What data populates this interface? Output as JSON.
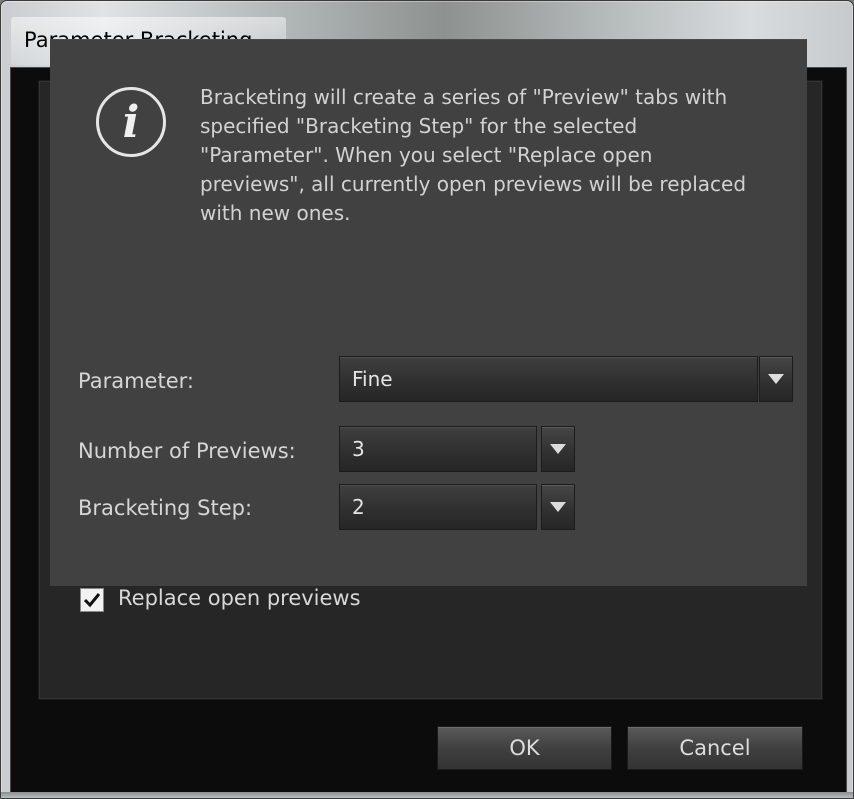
{
  "window": {
    "title": "Parameter Bracketing"
  },
  "info": {
    "icon_glyph": "i",
    "text": "Bracketing will create a series of \"Preview\" tabs with specified \"Bracketing Step\" for the selected \"Parameter\". When you select \"Replace open previews\", all currently open previews will be replaced with new ones."
  },
  "form": {
    "parameter_label": "Parameter:",
    "parameter_value": "Fine",
    "num_previews_label": "Number of Previews:",
    "num_previews_value": "3",
    "step_label": "Bracketing Step:",
    "step_value": "2",
    "replace_label": "Replace open previews",
    "replace_checked": true
  },
  "buttons": {
    "ok": "OK",
    "cancel": "Cancel"
  },
  "colors": {
    "panel": "#414141",
    "background": "#0c0c0c",
    "text": "#d6d6d6"
  }
}
